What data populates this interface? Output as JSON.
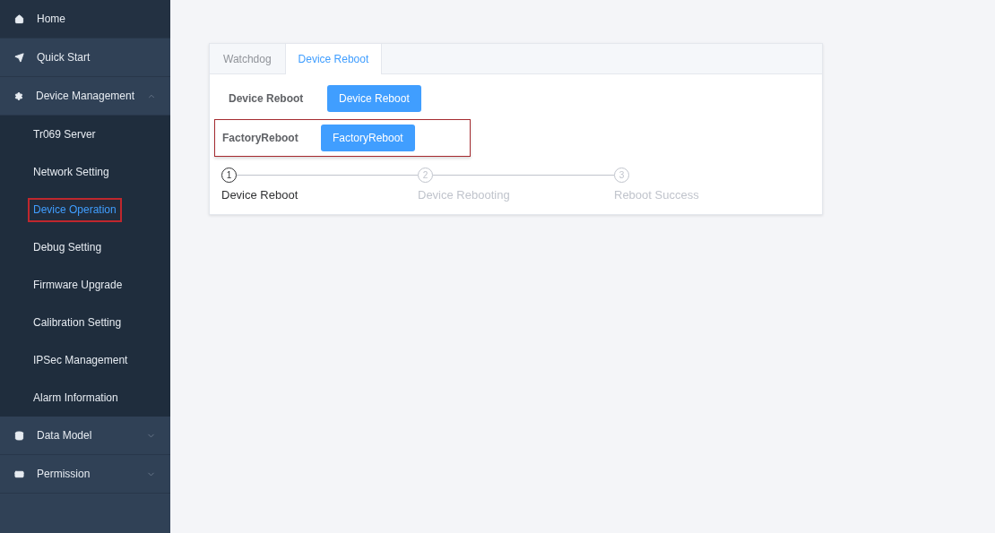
{
  "sidebar": {
    "items": [
      {
        "label": "Home"
      },
      {
        "label": "Quick Start"
      },
      {
        "label": "Device Management",
        "expanded": true,
        "children": [
          {
            "label": "Tr069 Server",
            "selected": false,
            "highlighted": false
          },
          {
            "label": "Network Setting",
            "selected": false,
            "highlighted": false
          },
          {
            "label": "Device Operation",
            "selected": true,
            "highlighted": true
          },
          {
            "label": "Debug Setting",
            "selected": false,
            "highlighted": false
          },
          {
            "label": "Firmware Upgrade",
            "selected": false,
            "highlighted": false
          },
          {
            "label": "Calibration Setting",
            "selected": false,
            "highlighted": false
          },
          {
            "label": "IPSec Management",
            "selected": false,
            "highlighted": false
          },
          {
            "label": "Alarm Information",
            "selected": false,
            "highlighted": false
          }
        ]
      },
      {
        "label": "Data Model",
        "expanded": false
      },
      {
        "label": "Permission",
        "expanded": false
      }
    ]
  },
  "tabs": [
    {
      "label": "Watchdog",
      "selected": false
    },
    {
      "label": "Device Reboot",
      "selected": true
    }
  ],
  "actions": [
    {
      "label": "Device Reboot",
      "button": "Device Reboot",
      "highlighted": false
    },
    {
      "label": "FactoryReboot",
      "button": "FactoryReboot",
      "highlighted": true
    }
  ],
  "steps": [
    {
      "number": "1",
      "label": "Device Reboot",
      "active": true
    },
    {
      "number": "2",
      "label": "Device Rebooting",
      "active": false
    },
    {
      "number": "3",
      "label": "Reboot Success",
      "active": false
    }
  ]
}
